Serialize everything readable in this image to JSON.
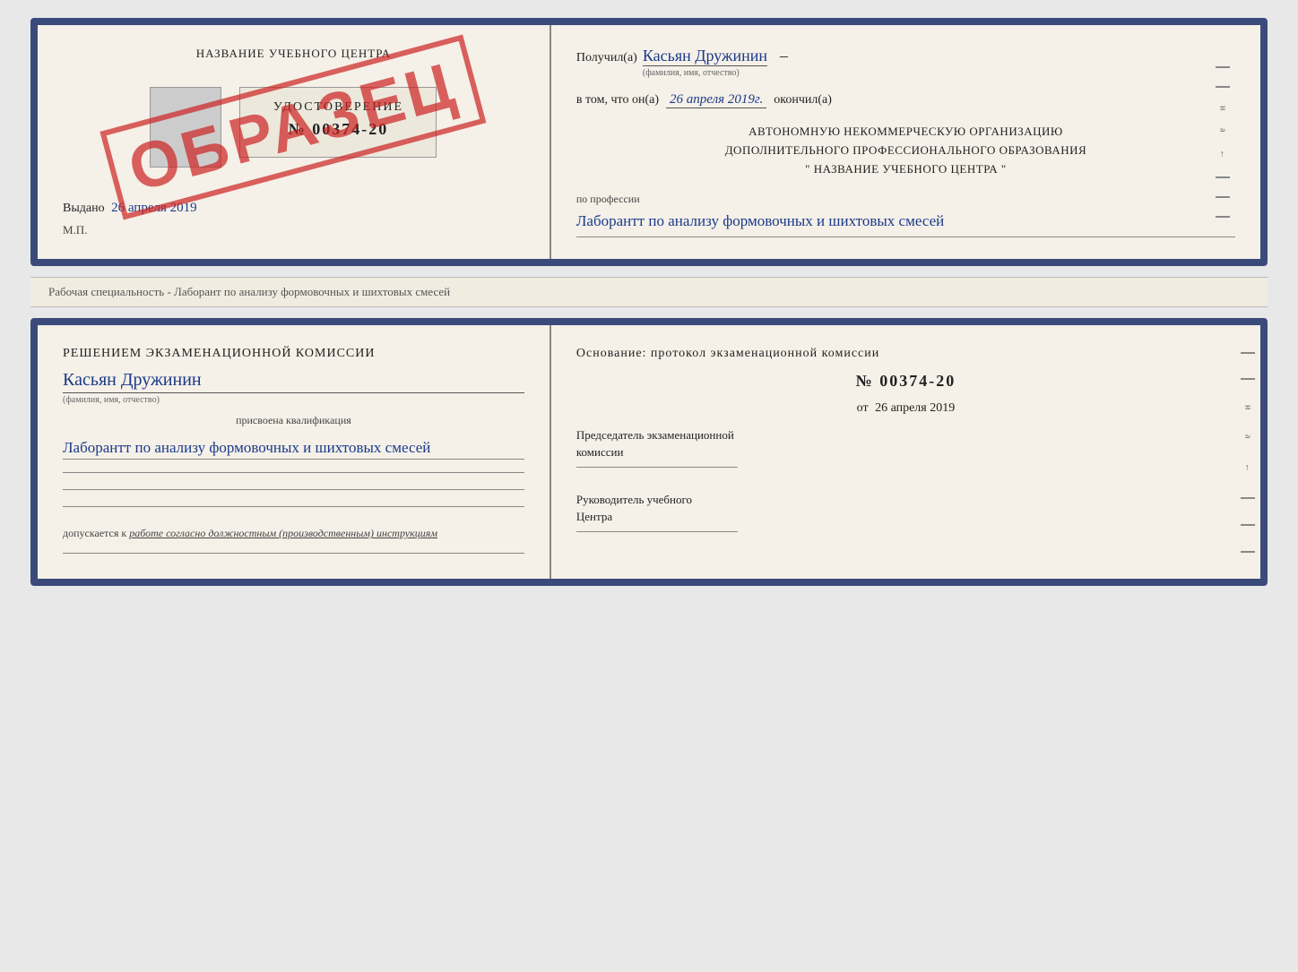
{
  "doc1": {
    "left": {
      "title": "НАЗВАНИЕ УЧЕБНОГО ЦЕНТРА",
      "cert_title": "УДОСТОВЕРЕНИЕ",
      "cert_number": "№ 00374-20",
      "stamp": "ОБРАЗЕЦ",
      "vydano_label": "Выдано",
      "vydano_date": "26 апреля 2019",
      "mp_label": "М.П."
    },
    "right": {
      "poluchil_label": "Получил(а)",
      "poluchil_name": "Касьян Дружинин",
      "poluchil_sub": "(фамилия, имя, отчество)",
      "vtom_label": "в том, что он(а)",
      "vtom_date": "26 апреля 2019г.",
      "okonchil_label": "окончил(а)",
      "auto_line1": "АВТОНОМНУЮ НЕКОММЕРЧЕСКУЮ ОРГАНИЗАЦИЮ",
      "auto_line2": "ДОПОЛНИТЕЛЬНОГО ПРОФЕССИОНАЛЬНОГО ОБРАЗОВАНИЯ",
      "auto_line3": "\"  НАЗВАНИЕ УЧЕБНОГО ЦЕНТРА  \"",
      "prof_label": "по профессии",
      "prof_val": "Лаборантт по анализу формовочных и шихтовых смесей"
    }
  },
  "spacer": {
    "text": "Рабочая специальность - Лаборант по анализу формовочных и шихтовых смесей"
  },
  "doc2": {
    "left": {
      "resheniem_title": "Решением экзаменационной комиссии",
      "name": "Касьян Дружинин",
      "name_sub": "(фамилия, имя, отчество)",
      "prisvoena_label": "присвоена квалификация",
      "kval": "Лаборантт по анализу формовочных и шихтовых смесей",
      "dopuskaetsya_label": "допускается к",
      "dopuskaetsya_val": "работе согласно должностным (производственным) инструкциям"
    },
    "right": {
      "osnovanie_title": "Основание: протокол экзаменационной комиссии",
      "protocol_number": "№ 00374-20",
      "ot_label": "от",
      "ot_date": "26 апреля 2019",
      "predsedatel_line1": "Председатель экзаменационной",
      "predsedatel_line2": "комиссии",
      "rukovoditel_line1": "Руководитель учебного",
      "rukovoditel_line2": "Центра"
    }
  }
}
